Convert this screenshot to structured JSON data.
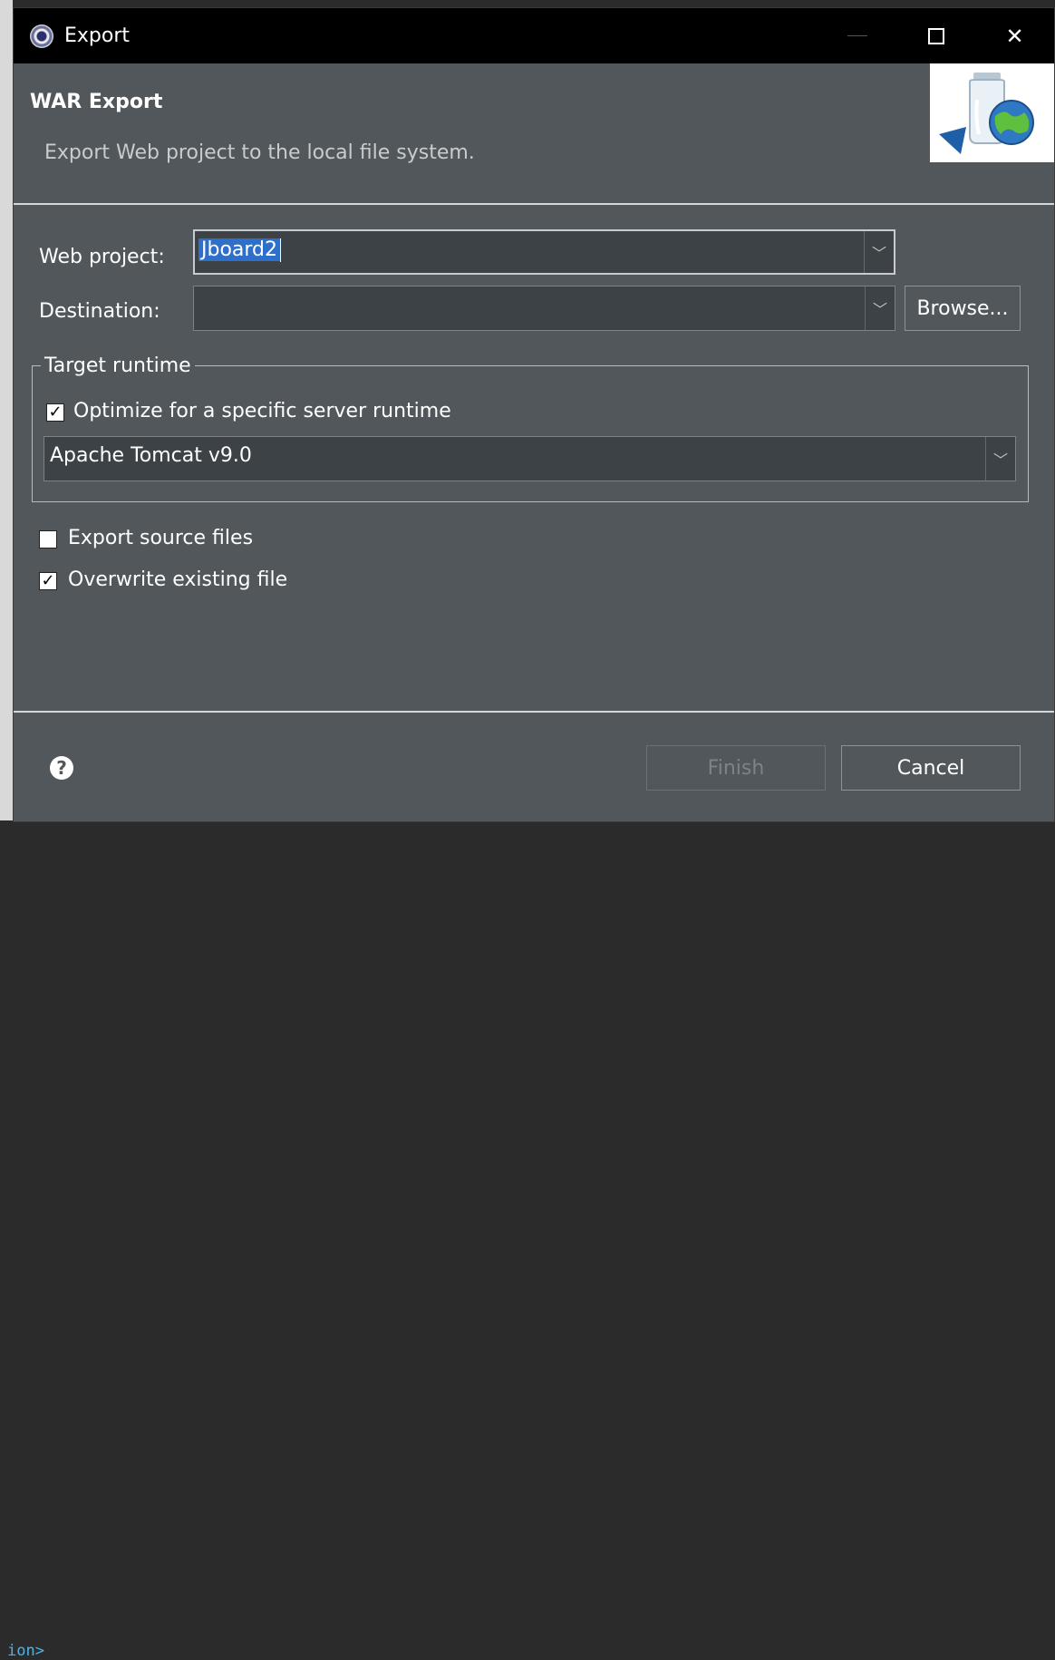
{
  "window": {
    "title": "Export",
    "minimize": "—",
    "close": "✕"
  },
  "header": {
    "title": "WAR Export",
    "description": "Export Web project to the local file system."
  },
  "form": {
    "web_project_label": "Web project:",
    "web_project_value": "Jboard2",
    "destination_label": "Destination:",
    "destination_value": "",
    "browse_label": "Browse...",
    "target_runtime_label": "Target runtime",
    "optimize_label": "Optimize for a specific server runtime",
    "optimize_checked": true,
    "runtime_value": "Apache Tomcat v9.0",
    "export_source_label": "Export source files",
    "export_source_checked": false,
    "overwrite_label": "Overwrite existing file",
    "overwrite_checked": true
  },
  "footer": {
    "help": "?",
    "finish_label": "Finish",
    "cancel_label": "Cancel"
  },
  "background": {
    "code_fragment": "ion>"
  },
  "colors": {
    "dialog_bg": "#51575b",
    "titlebar_bg": "#000000",
    "selection": "#2d6fc9"
  }
}
